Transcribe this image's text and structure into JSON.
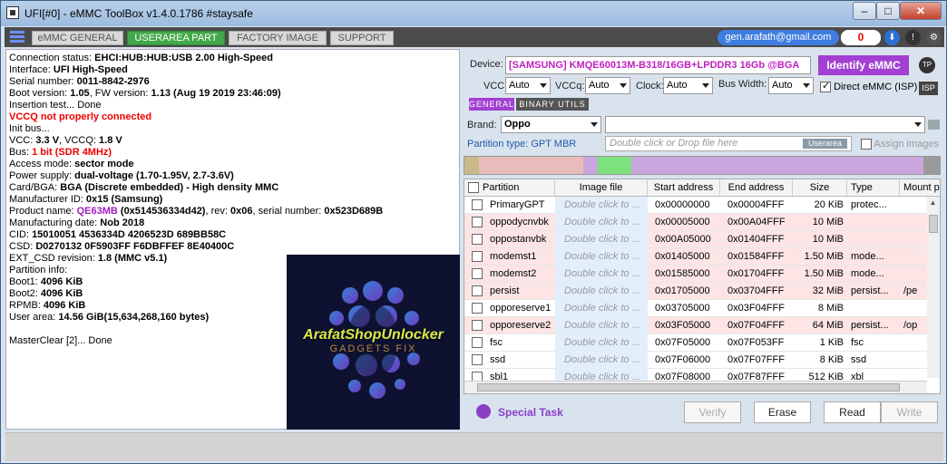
{
  "window": {
    "title": "UFI[#0] - eMMC ToolBox v1.4.0.1786 #staysafe",
    "min": "–",
    "max": "□",
    "close": "✕"
  },
  "tabs": [
    "eMMC GENERAL",
    "USERAREA PART",
    "FACTORY IMAGE",
    "SUPPORT"
  ],
  "account": {
    "email": "gen.arafath@gmail.com",
    "credit": "0"
  },
  "log": {
    "l1a": "Connection status: ",
    "l1b": "EHCI:HUB:HUB:USB 2.00 High-Speed",
    "l2a": "Interface: ",
    "l2b": "UFI High-Speed",
    "l3a": "Serial number: ",
    "l3b": "0011-8842-2976",
    "l4a": " Boot version: ",
    "l4b": "1.05",
    "l4c": ", FW version: ",
    "l4d": "1.13 (Aug 19 2019 23:46:09)",
    "l5": "Insertion test... Done",
    "l6": "VCCQ not properly connected",
    "l7": "Init bus...",
    "l8a": "VCC: ",
    "l8b": "3.3 V",
    "l8c": ", VCCQ: ",
    "l8d": "1.8 V",
    "l9a": "Bus: ",
    "l9b": "1 bit (SDR 4MHz)",
    "l10a": "Access mode: ",
    "l10b": "sector mode",
    "l11a": "Power supply: ",
    "l11b": "dual-voltage (1.70-1.95V, 2.7-3.6V)",
    "l12a": " Card/BGA: ",
    "l12b": "BGA (Discrete embedded) - High density MMC",
    "l13a": " Manufacturer ID: ",
    "l13b": "0x15 (Samsung)",
    "l14a": " Product name: ",
    "l14b": "QE63MB",
    "l14c": " (0x514536334d42)",
    "l14d": ", rev: ",
    "l14e": "0x06",
    "l14f": ", serial number: ",
    "l14g": "0x523D689B",
    "l15a": " Manufacturing date: ",
    "l15b": "Nob 2018",
    "l16a": "CID: ",
    "l16b": "15010051 4536334D 4206523D 689BB58C",
    "l17a": "CSD: ",
    "l17b": "D0270132 0F5903FF F6DBFFEF 8E40400C",
    "l18a": "EXT_CSD revision: ",
    "l18b": "1.8 (MMC v5.1)",
    "l19": "Partition info:",
    "l20a": " Boot1: ",
    "l20b": "4096 KiB",
    "l21a": " Boot2: ",
    "l21b": "4096 KiB",
    "l22a": " RPMB: ",
    "l22b": "4096 KiB",
    "l23a": " User area: ",
    "l23b": "14.56 GiB(15,634,268,160 bytes)",
    "l24": "MasterClear [2]... Done"
  },
  "logo": {
    "name": "ArafatShopUnlocker",
    "sub": "GADGETS FIX"
  },
  "device": {
    "label": "Device:",
    "value": "[SAMSUNG] KMQE60013M-B318/16GB+LPDDR3 16Gb  @BGA",
    "identify": "Identify eMMC",
    "tp": "TP"
  },
  "voltage": {
    "vcc_label": "VCC:",
    "vcc": "Auto",
    "vccq_label": "VCCq:",
    "vccq": "Auto",
    "clock_label": "Clock:",
    "clock": "Auto",
    "bus_label": "Bus Width:",
    "bus": "Auto",
    "direct": "Direct eMMC (ISP)",
    "isp": "ISP"
  },
  "subtabs": [
    "GENERAL",
    "BINARY UTILS"
  ],
  "brand": {
    "label": "Brand:",
    "value": "Oppo",
    "model": ""
  },
  "partition_type": "Partition type: GPT MBR",
  "drop": {
    "placeholder": "Double click or Drop file here",
    "badge": "Userarea",
    "assign": "Assign images"
  },
  "partbar": [
    {
      "color": "#c9b98a",
      "w": 0.03
    },
    {
      "color": "#e9bcbc",
      "w": 0.22
    },
    {
      "color": "#c9a6dd",
      "w": 0.03
    },
    {
      "color": "#7de27d",
      "w": 0.07
    },
    {
      "color": "#c9a6dd",
      "w": 0.615
    },
    {
      "color": "#9a9a9a",
      "w": 0.035
    }
  ],
  "table": {
    "headers": [
      "Partition",
      "Image file",
      "Start address",
      "End address",
      "Size",
      "Type",
      "Mount p"
    ],
    "imgtext": "Double click to ...",
    "rows": [
      {
        "name": "PrimaryGPT",
        "start": "0x00000000",
        "end": "0x00004FFF",
        "size": "20 KiB",
        "type": "protec...",
        "mount": "",
        "pink": false
      },
      {
        "name": "oppodycnvbk",
        "start": "0x00005000",
        "end": "0x00A04FFF",
        "size": "10 MiB",
        "type": "",
        "mount": "",
        "pink": true
      },
      {
        "name": "oppostanvbk",
        "start": "0x00A05000",
        "end": "0x01404FFF",
        "size": "10 MiB",
        "type": "",
        "mount": "",
        "pink": true
      },
      {
        "name": "modemst1",
        "start": "0x01405000",
        "end": "0x01584FFF",
        "size": "1.50 MiB",
        "type": "mode...",
        "mount": "",
        "pink": true
      },
      {
        "name": "modemst2",
        "start": "0x01585000",
        "end": "0x01704FFF",
        "size": "1.50 MiB",
        "type": "mode...",
        "mount": "",
        "pink": true
      },
      {
        "name": "persist",
        "start": "0x01705000",
        "end": "0x03704FFF",
        "size": "32 MiB",
        "type": "persist...",
        "mount": "/pe",
        "pink": true
      },
      {
        "name": "opporeserve1",
        "start": "0x03705000",
        "end": "0x03F04FFF",
        "size": "8 MiB",
        "type": "",
        "mount": "",
        "pink": false
      },
      {
        "name": "opporeserve2",
        "start": "0x03F05000",
        "end": "0x07F04FFF",
        "size": "64 MiB",
        "type": "persist...",
        "mount": "/op",
        "pink": true
      },
      {
        "name": "fsc",
        "start": "0x07F05000",
        "end": "0x07F053FF",
        "size": "1 KiB",
        "type": "fsc",
        "mount": "",
        "pink": false
      },
      {
        "name": "ssd",
        "start": "0x07F06000",
        "end": "0x07F07FFF",
        "size": "8 KiB",
        "type": "ssd",
        "mount": "",
        "pink": false
      },
      {
        "name": "sbl1",
        "start": "0x07F08000",
        "end": "0x07F87FFF",
        "size": "512 KiB",
        "type": "xbl",
        "mount": "",
        "pink": false
      }
    ]
  },
  "actions": {
    "special": "Special Task",
    "verify": "Verify",
    "erase": "Erase",
    "read": "Read",
    "write": "Write"
  }
}
